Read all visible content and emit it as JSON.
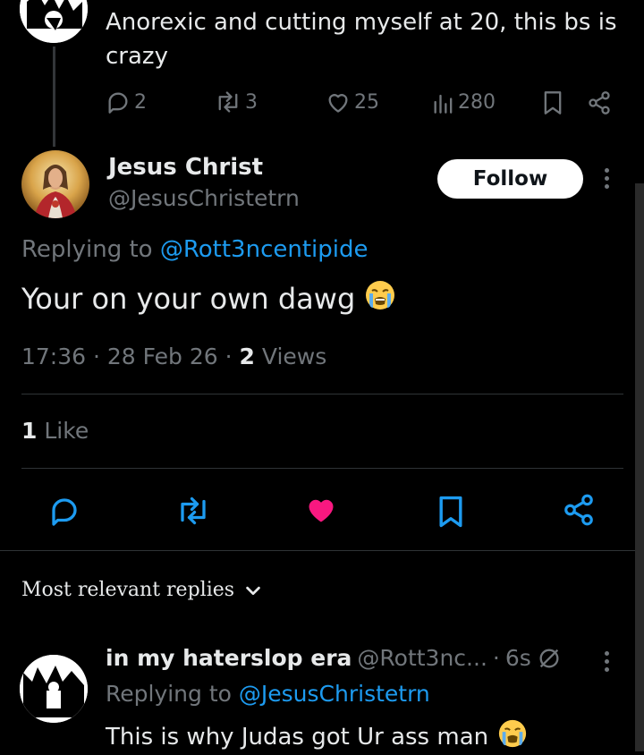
{
  "parent_tweet": {
    "text_line1": "Anorexic and cutting myself at 20, this bs is",
    "text_line2": "crazy",
    "replies": "2",
    "reposts": "3",
    "likes": "25",
    "views": "280"
  },
  "main_tweet": {
    "display_name": "Jesus Christ",
    "handle": "@JesusChristetrn",
    "follow_label": "Follow",
    "replying_prefix": "Replying to",
    "replying_handle": "@Rott3ncentipide",
    "text": "Your on your own dawg",
    "time": "17:36",
    "date": "28 Feb 26",
    "views_count": "2",
    "views_label": "Views",
    "like_count": "1",
    "like_label": "Like"
  },
  "replies_section": {
    "sort_label": "Most relevant replies"
  },
  "reply_tweet": {
    "display_name": "in my haterslop era",
    "handle": "@Rott3nc...",
    "time": "6s",
    "replying_prefix": "Replying to",
    "replying_handle": "@JesusChristetrn",
    "text": "This is why Judas got Ur ass man"
  },
  "colors": {
    "background": "#000000",
    "text": "#e7e9ea",
    "muted": "#71767b",
    "link": "#1d9bf0",
    "like_active": "#f91880"
  },
  "icons": [
    "reply-icon",
    "repost-icon",
    "like-icon",
    "views-icon",
    "bookmark-icon",
    "share-icon",
    "more-icon",
    "chevron-down-icon",
    "crying-emoji-icon",
    "circle-slash-icon"
  ]
}
